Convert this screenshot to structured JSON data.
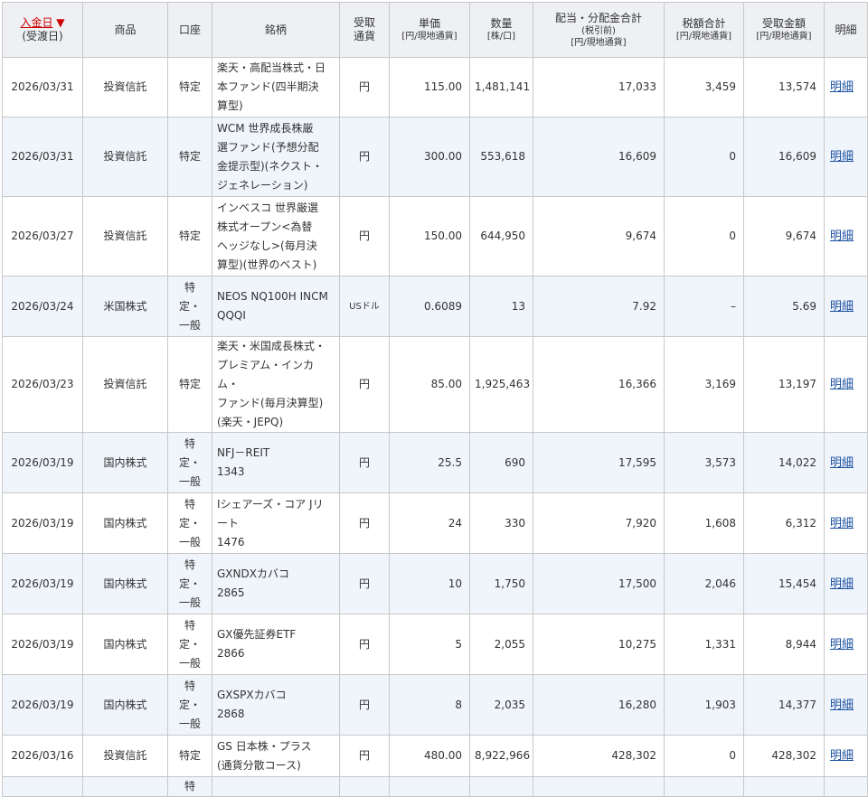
{
  "headers": {
    "date": "入金日",
    "date_arrow": "▼",
    "date_sub": "(受渡日)",
    "product": "商品",
    "account": "口座",
    "name": "銘柄",
    "currency_1": "受取",
    "currency_2": "通貨",
    "price": "単価",
    "price_unit": "[円/現地通貨]",
    "qty": "数量",
    "qty_unit": "[株/口]",
    "dividend": "配当・分配金合計",
    "dividend_sub": "(税引前)",
    "dividend_unit": "[円/現地通貨]",
    "tax": "税額合計",
    "tax_unit": "[円/現地通貨]",
    "received": "受取金額",
    "received_unit": "[円/現地通貨]",
    "detail": "明細"
  },
  "rows": [
    {
      "date": "2026/03/31",
      "product": "投資信託",
      "account_lines": [
        "特定"
      ],
      "name_lines": [
        "楽天・高配当株式・日",
        "本ファンド(四半期決",
        "算型)"
      ],
      "currency": "円",
      "price": "115.00",
      "qty": "1,481,141",
      "dividend": "17,033",
      "tax": "3,459",
      "received": "13,574",
      "detail": "明細",
      "height": 66
    },
    {
      "date": "2026/03/31",
      "product": "投資信託",
      "account_lines": [
        "特定"
      ],
      "name_lines": [
        "WCM 世界成長株厳",
        "選ファンド(予想分配",
        "金提示型)(ネクスト・",
        "ジェネレーション)"
      ],
      "currency": "円",
      "price": "300.00",
      "qty": "553,618",
      "dividend": "16,609",
      "tax": "0",
      "received": "16,609",
      "detail": "明細",
      "height": 88
    },
    {
      "date": "2026/03/27",
      "product": "投資信託",
      "account_lines": [
        "特定"
      ],
      "name_lines": [
        "インベスコ 世界厳選",
        "株式オープン<為替",
        "ヘッジなし>(毎月決",
        "算型)(世界のベスト)"
      ],
      "currency": "円",
      "price": "150.00",
      "qty": "644,950",
      "dividend": "9,674",
      "tax": "0",
      "received": "9,674",
      "detail": "明細",
      "height": 88
    },
    {
      "date": "2026/03/24",
      "product": "米国株式",
      "account_lines": [
        "特",
        "定・",
        "一般"
      ],
      "name_lines": [
        "NEOS NQ100H INCM",
        "QQQI"
      ],
      "currency": "USドル",
      "currency_small": true,
      "price": "0.6089",
      "qty": "13",
      "dividend": "7.92",
      "tax": "–",
      "received": "5.69",
      "detail": "明細",
      "height": 67
    },
    {
      "date": "2026/03/23",
      "product": "投資信託",
      "account_lines": [
        "特定"
      ],
      "name_lines": [
        "楽天・米国成長株式・",
        "プレミアム・インカム・",
        "ファンド(毎月決算型)",
        "(楽天・JEPQ)"
      ],
      "currency": "円",
      "price": "85.00",
      "qty": "1,925,463",
      "dividend": "16,366",
      "tax": "3,169",
      "received": "13,197",
      "detail": "明細",
      "height": 88
    },
    {
      "date": "2026/03/19",
      "product": "国内株式",
      "account_lines": [
        "特",
        "定・",
        "一般"
      ],
      "name_lines": [
        "NFJ－REIT",
        "1343"
      ],
      "currency": "円",
      "price": "25.5",
      "qty": "690",
      "dividend": "17,595",
      "tax": "3,573",
      "received": "14,022",
      "detail": "明細",
      "height": 67
    },
    {
      "date": "2026/03/19",
      "product": "国内株式",
      "account_lines": [
        "特",
        "定・",
        "一般"
      ],
      "name_lines": [
        "Iシェアーズ・コア Jリ",
        "ート",
        "1476"
      ],
      "currency": "円",
      "price": "24",
      "qty": "330",
      "dividend": "7,920",
      "tax": "1,608",
      "received": "6,312",
      "detail": "明細",
      "height": 67
    },
    {
      "date": "2026/03/19",
      "product": "国内株式",
      "account_lines": [
        "特",
        "定・",
        "一般"
      ],
      "name_lines": [
        "GXNDXカバコ",
        "2865"
      ],
      "currency": "円",
      "price": "10",
      "qty": "1,750",
      "dividend": "17,500",
      "tax": "2,046",
      "received": "15,454",
      "detail": "明細",
      "height": 67
    },
    {
      "date": "2026/03/19",
      "product": "国内株式",
      "account_lines": [
        "特",
        "定・",
        "一般"
      ],
      "name_lines": [
        "GX優先証券ETF",
        "2866"
      ],
      "currency": "円",
      "price": "5",
      "qty": "2,055",
      "dividend": "10,275",
      "tax": "1,331",
      "received": "8,944",
      "detail": "明細",
      "height": 67
    },
    {
      "date": "2026/03/19",
      "product": "国内株式",
      "account_lines": [
        "特",
        "定・",
        "一般"
      ],
      "name_lines": [
        "GXSPXカバコ",
        "2868"
      ],
      "currency": "円",
      "price": "8",
      "qty": "2,035",
      "dividend": "16,280",
      "tax": "1,903",
      "received": "14,377",
      "detail": "明細",
      "height": 67
    },
    {
      "date": "2026/03/16",
      "product": "投資信託",
      "account_lines": [
        "特定"
      ],
      "name_lines": [
        "GS 日本株・プラス",
        "(通貨分散コース)"
      ],
      "currency": "円",
      "price": "480.00",
      "qty": "8,922,966",
      "dividend": "428,302",
      "tax": "0",
      "received": "428,302",
      "detail": "明細",
      "height": 46
    },
    {
      "date": "",
      "product": "",
      "account_lines": [
        "特"
      ],
      "name_lines": [
        ""
      ],
      "currency": "",
      "price": "",
      "qty": "",
      "dividend": "",
      "tax": "",
      "received": "",
      "detail": "",
      "height": 20
    }
  ]
}
